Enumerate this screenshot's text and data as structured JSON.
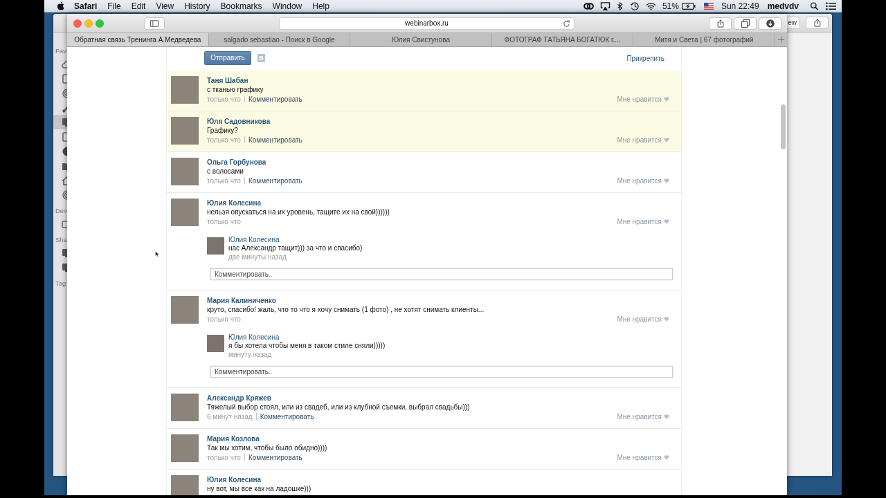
{
  "menu_bar": {
    "app": "Safari",
    "menus": [
      "File",
      "Edit",
      "View",
      "History",
      "Bookmarks",
      "Window",
      "Help"
    ],
    "battery": "51%",
    "clock": "Sun 22:49",
    "user": "medvdv"
  },
  "back_window": {
    "toolbar_button": "ew",
    "sidebar_sections": [
      {
        "label": "Fav",
        "items": [
          {
            "selected": false
          },
          {
            "selected": false
          },
          {
            "selected": false
          },
          {
            "selected": false
          },
          {
            "selected": true
          },
          {
            "selected": false
          },
          {
            "selected": false
          },
          {
            "selected": false
          },
          {
            "selected": false
          },
          {
            "selected": false
          }
        ]
      },
      {
        "label": "Dev",
        "items": [
          {
            "selected": false
          }
        ]
      },
      {
        "label": "Sha",
        "items": [
          {
            "selected": false
          },
          {
            "selected": false
          }
        ]
      },
      {
        "label": "Tag"
      }
    ]
  },
  "browser": {
    "address": "webinarbox.ru",
    "tabs": [
      {
        "title": "Обратная связь Тренинга А.Медведева",
        "selected": true
      },
      {
        "title": "salgado sebastiao - Поиск в Google",
        "selected": false
      },
      {
        "title": "Юлия Свистунова",
        "selected": false
      },
      {
        "title": "ФОТОГРАФ ТАТЬЯНА БОГАТЮК г....",
        "selected": false
      },
      {
        "title": "Митя и Света | 67 фотографий",
        "selected": false
      }
    ]
  },
  "page": {
    "send_button": "Отправить",
    "vk_button": "В",
    "attach_link": "Прикрепить",
    "comments": [
      {
        "author": "Таня Шабан",
        "text": "с тканью графику",
        "time": "только что",
        "comment_link": "Комментировать",
        "like": "Мне нравится",
        "highlighted": true
      },
      {
        "author": "Юля Садовникова",
        "text": "Графику?",
        "time": "только что",
        "comment_link": "Комментировать",
        "like": "Мне нравится",
        "highlighted": true
      },
      {
        "author": "Ольга Горбунова",
        "text": "с волосами",
        "time": "только что",
        "comment_link": "Комментировать",
        "like": "Мне нравится",
        "highlighted": false
      },
      {
        "author": "Юлия Колесина",
        "text": "нельзя опускаться на их уровень, тащите их на свой))))))",
        "time": "только что",
        "like": "Мне нравится",
        "highlighted": false,
        "replies": [
          {
            "author": "Юлия Колесина",
            "text": "нас Александр тащит))) за что и спасибо)",
            "time": "две минуты назад"
          }
        ],
        "reply_placeholder": "Комментировать.."
      },
      {
        "author": "Мария Калиниченко",
        "text": "круто, спасибо! жаль, что то что я хочу снимать (1 фото) , не хотят снимать клиенты...",
        "time": "только что",
        "like": "Мне нравится",
        "highlighted": false,
        "replies": [
          {
            "author": "Юлия Колесина",
            "text": "я бы хотела чтобы меня в таком стиле сняли)))))",
            "time": "минуту назад"
          }
        ],
        "reply_placeholder": "Комментировать.."
      },
      {
        "author": "Александр Кряжев",
        "text": "Тяжелый выбор стоял, или из свадеб, или из клубной съемки, выбрал свадьбы)))",
        "time": "6 минут назад",
        "comment_link": "Комментировать",
        "like": "Мне нравится",
        "highlighted": false
      },
      {
        "author": "Мария Козлова",
        "text": "Так мы хотим, чтобы было обидно))))",
        "time": "только что",
        "comment_link": "Комментировать",
        "like": "Мне нравится",
        "highlighted": false
      },
      {
        "author": "Юлия Колесина",
        "text": "ну вот, мы все как на ладошке)))",
        "highlighted": false
      }
    ]
  }
}
